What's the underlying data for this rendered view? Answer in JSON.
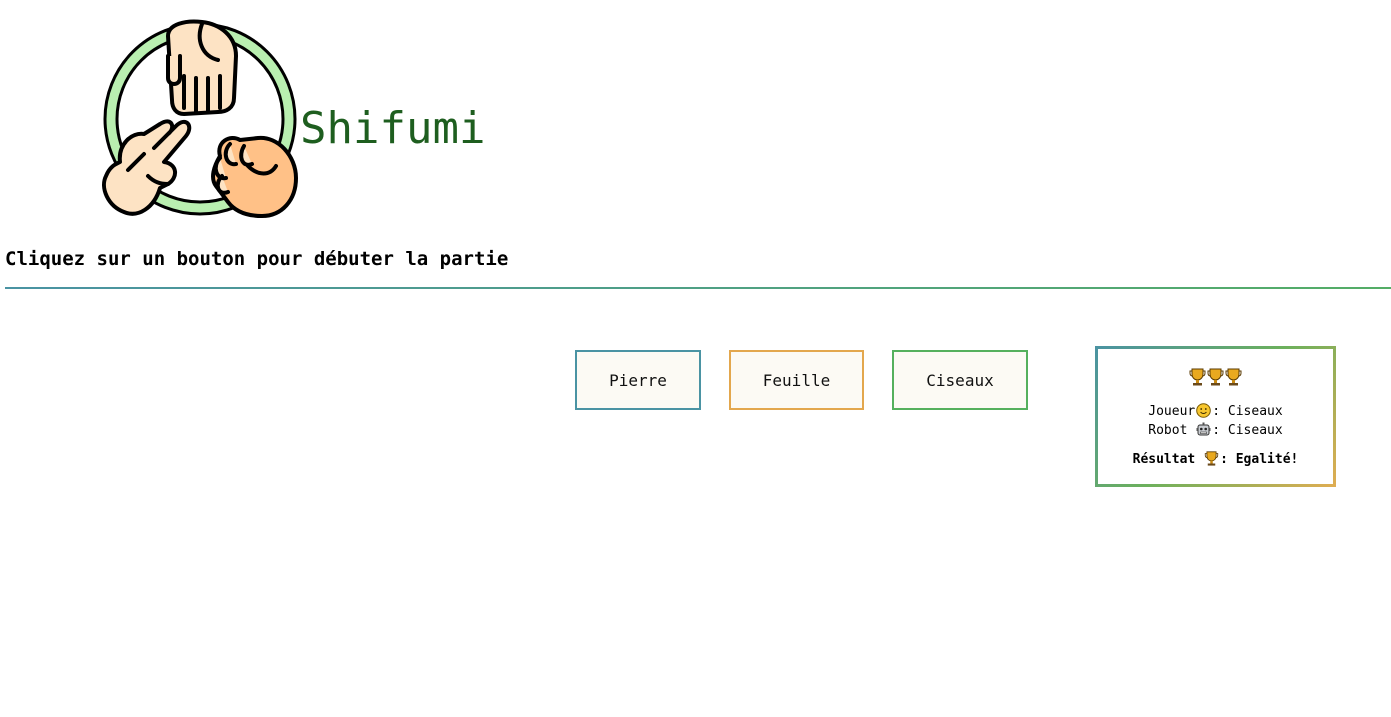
{
  "header": {
    "title": "Shifumi",
    "logo_icon": "rock-paper-scissors-hands-icon"
  },
  "instruction": "Cliquez sur un bouton pour débuter la partie",
  "buttons": {
    "pierre": "Pierre",
    "feuille": "Feuille",
    "ciseaux": "Ciseaux"
  },
  "scoreboard": {
    "trophy_icon": "trophy-icon",
    "joueur_label": "Joueur",
    "joueur_icon": "smiley-face-icon",
    "joueur_choice": ": Ciseaux",
    "robot_label": "Robot ",
    "robot_icon": "robot-face-icon",
    "robot_choice": ": Ciseaux",
    "result_label": "Résultat ",
    "result_icon": "trophy-icon",
    "result_value": ": Egalité!"
  },
  "colors": {
    "title": "#1e5e1f",
    "pierre_border": "#4a93a3",
    "feuille_border": "#e3a74d",
    "ciseaux_border": "#55b05d",
    "button_bg": "#fcfaf4"
  }
}
